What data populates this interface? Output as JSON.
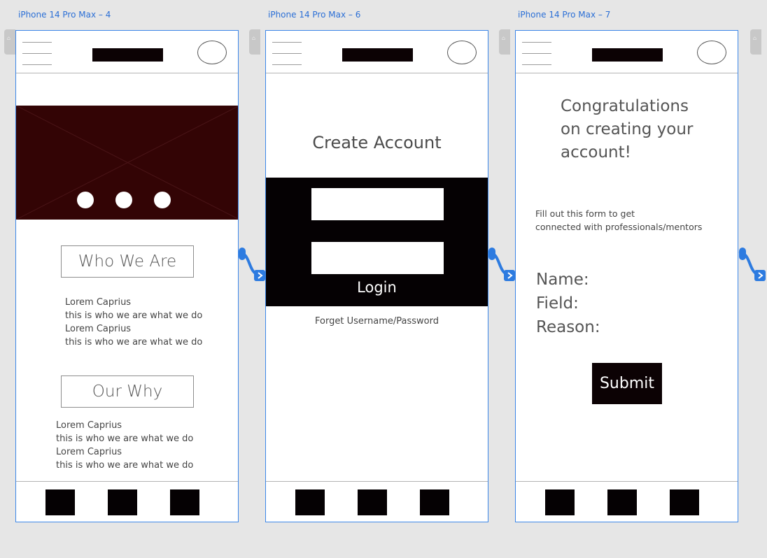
{
  "artboards": [
    {
      "title": "iPhone 14 Pro Max – 4",
      "sections": [
        {
          "heading": "Who We Are",
          "lines": [
            "Lorem Caprius",
            "this is who we are what we do",
            "Lorem Caprius",
            "this is who we are what we do"
          ]
        },
        {
          "heading": "Our Why",
          "lines": [
            "Lorem Caprius",
            "this is who we are what we do",
            "Lorem Caprius",
            "this is who we are what we do"
          ]
        }
      ]
    },
    {
      "title": "iPhone 14 Pro Max – 6",
      "heading": "Create Account",
      "login_label": "Login",
      "forgot_link": "Forget Username/Password"
    },
    {
      "title": "iPhone 14 Pro Max – 7",
      "congrats_lines": [
        "Congratulations",
        "on creating your",
        "account!"
      ],
      "form_note_lines": [
        "Fill out this form to get",
        "connected with professionals/mentors"
      ],
      "field_labels": [
        "Name:",
        "Field:",
        "Reason:"
      ],
      "submit_label": "Submit"
    }
  ],
  "colors": {
    "artboard_border": "#3b86e8",
    "title_text": "#2b6fd6",
    "hero_fill": "#330405",
    "dark_fill": "#050103",
    "canvas": "#e6e6e6"
  },
  "icons": [
    "hamburger-menu-icon",
    "profile-circle-icon",
    "home-icon",
    "prototype-link-icon"
  ]
}
